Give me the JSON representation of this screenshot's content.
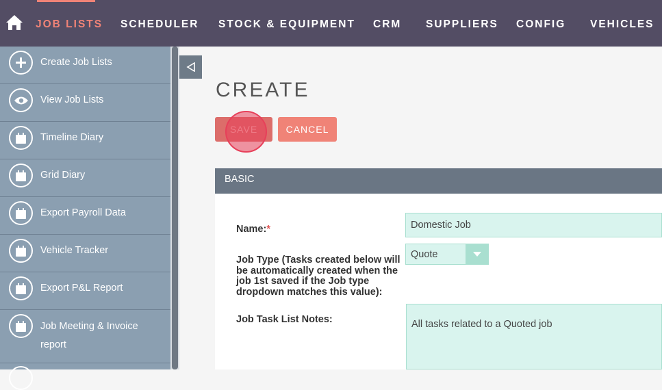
{
  "nav": {
    "items": [
      {
        "label": "JOB LISTS",
        "active": true
      },
      {
        "label": "SCHEDULER"
      },
      {
        "label": "STOCK & EQUIPMENT"
      },
      {
        "label": "CRM"
      },
      {
        "label": "SUPPLIERS"
      },
      {
        "label": "CONFIG"
      },
      {
        "label": "VEHICLES"
      }
    ],
    "home_icon": "home-icon",
    "accent_color": "#f08377"
  },
  "sidebar": {
    "items": [
      {
        "label": "Create Job Lists",
        "icon": "plus-icon"
      },
      {
        "label": "View Job Lists",
        "icon": "eye-icon"
      },
      {
        "label": "Timeline Diary",
        "icon": "calendar-icon"
      },
      {
        "label": "Grid Diary",
        "icon": "calendar-icon"
      },
      {
        "label": "Export Payroll Data",
        "icon": "calendar-icon"
      },
      {
        "label": "Vehicle Tracker",
        "icon": "calendar-icon"
      },
      {
        "label": "Export P&L Report",
        "icon": "calendar-icon"
      },
      {
        "label": "Job Meeting & Invoice report",
        "icon": "calendar-icon"
      }
    ]
  },
  "main": {
    "title": "CREATE",
    "save_label": "SAVE",
    "cancel_label": "CANCEL",
    "panel_title": "BASIC",
    "fields": {
      "name_label": "Name:",
      "name_required": "*",
      "name_value": "Domestic Job",
      "job_type_label": "Job Type (Tasks created below will be automatically created when the job 1st saved if the Job type dropdown matches this value):",
      "job_type_value": "Quote",
      "notes_label": "Job Task List Notes:",
      "notes_value": "All tasks related to a Quoted job"
    }
  }
}
